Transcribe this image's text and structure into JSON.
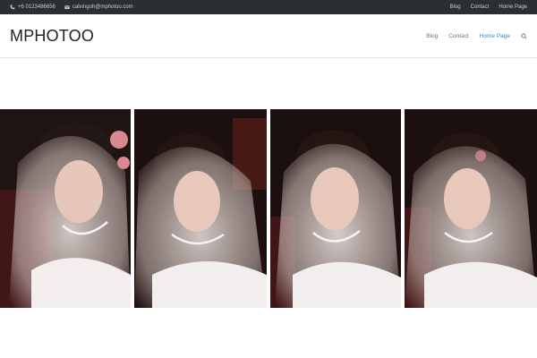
{
  "topbar": {
    "phone": "+6 0123486656",
    "email": "calvingoh@mphotoo.com",
    "links": [
      "Blog",
      "Contact",
      "Home Page"
    ]
  },
  "header": {
    "logo": "MPHOTOO",
    "nav": [
      "Blog",
      "Contact",
      "Home Page"
    ],
    "active_nav": "Home Page"
  },
  "icons": {
    "phone": "phone-icon",
    "email": "envelope-icon",
    "search": "search-icon"
  },
  "colors": {
    "topbar_bg": "#2b2e33",
    "accent": "#2e8fd0",
    "text": "#222222"
  }
}
